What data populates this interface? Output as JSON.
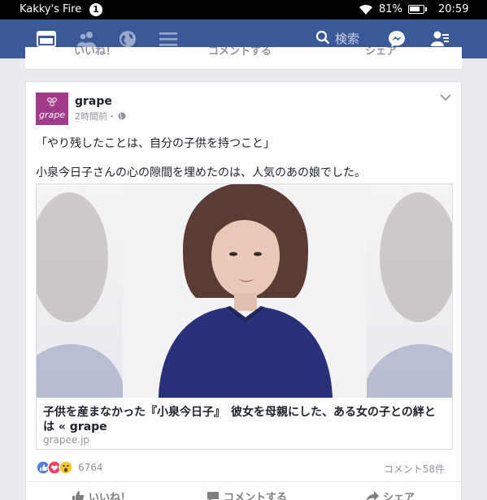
{
  "status_bar": {
    "app_name": "Kakky's Fire",
    "notification_count": "1",
    "battery_percent": "81%",
    "battery_level": 0.81,
    "time": "20:59"
  },
  "navbar": {
    "search_placeholder": "検索",
    "color": "#3b5998"
  },
  "previous_post": {
    "actions": [
      "いいね！",
      "コメントする",
      "シェア"
    ]
  },
  "post": {
    "page_name": "grape",
    "avatar_text": "grape",
    "time": "2時間前・",
    "text_line1": "「やり残したことは、自分の子供を持つこと」",
    "text_line2": "小泉今日子さんの心の隙間を埋めたのは、人気のあの娘でした。",
    "link": {
      "title": "子供を産まなかった『小泉今日子』　彼女を母親にした、ある女の子との絆とは « grape",
      "domain": "grapee.jp"
    },
    "reaction_count": "6764",
    "comment_count": "コメント58件",
    "actions": {
      "like": "いいね！",
      "comment": "コメントする",
      "share": "シェア"
    }
  }
}
